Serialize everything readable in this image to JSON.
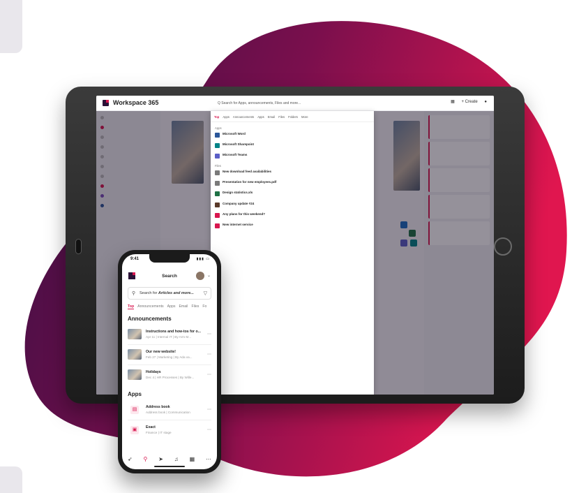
{
  "brand": {
    "name": "Workspace 365",
    "accent": "#d8174f",
    "dark": "#2b1137"
  },
  "tablet": {
    "search": {
      "placeholder": "Q Search for Apps, announcements, Files and more..."
    },
    "create_label": "+ Create",
    "overlay": {
      "tabs": [
        "Top",
        "Apps",
        "Announcements",
        "Apps",
        "Email",
        "Files",
        "Folders",
        "More"
      ],
      "sections": [
        {
          "heading": "Apps",
          "items": [
            {
              "title": "Microsoft Word",
              "sub": "",
              "color": "#2b579a"
            },
            {
              "title": "Microsoft Sharepoint",
              "sub": "",
              "color": "#038387"
            },
            {
              "title": "Microsoft Teams",
              "sub": "",
              "color": "#5b5fc7"
            }
          ]
        },
        {
          "heading": "Files",
          "items": [
            {
              "title": "New download feed availabilities",
              "sub": "",
              "color": "#7a7a7a"
            },
            {
              "title": "Presentation for new employees.pdf",
              "sub": "",
              "color": "#7a7a7a"
            },
            {
              "title": "Design statistics.xls",
              "sub": "",
              "color": "#1e7145"
            }
          ],
          "more": ""
        },
        {
          "heading": "",
          "items": [
            {
              "title": "Company update #24",
              "sub": "",
              "color": "#5a3a2a"
            },
            {
              "title": "Any plans for this weekend?",
              "sub": "",
              "color": "#d8174f"
            },
            {
              "title": "New internet service",
              "sub": "",
              "color": "#d8174f"
            }
          ]
        }
      ]
    }
  },
  "phone": {
    "time": "9:41",
    "title": "Search",
    "search_prefix": "Search for ",
    "search_emph": "Articles and more...",
    "tabs": [
      "Top",
      "Announcements",
      "Apps",
      "Email",
      "Files",
      "Fo"
    ],
    "announcements_heading": "Announcements",
    "announcements": [
      {
        "title": "Instructions and how-tos for o...",
        "sub": "Apr 11 | Internal IT | By Arm M..."
      },
      {
        "title": "Our new website!",
        "sub": "Feb 27 | Marketing | By Ada va..."
      },
      {
        "title": "Holidays",
        "sub": "Dec 4 | HR Processes | By Wille..."
      }
    ],
    "apps_heading": "Apps",
    "apps": [
      {
        "title": "Address book",
        "sub": "Address book | Communication"
      },
      {
        "title": "Exact",
        "sub": "Finance | IT stage"
      }
    ],
    "nav": [
      "rocket-icon",
      "search-icon",
      "send-icon",
      "bell-icon",
      "grid-icon",
      "more-icon"
    ]
  }
}
